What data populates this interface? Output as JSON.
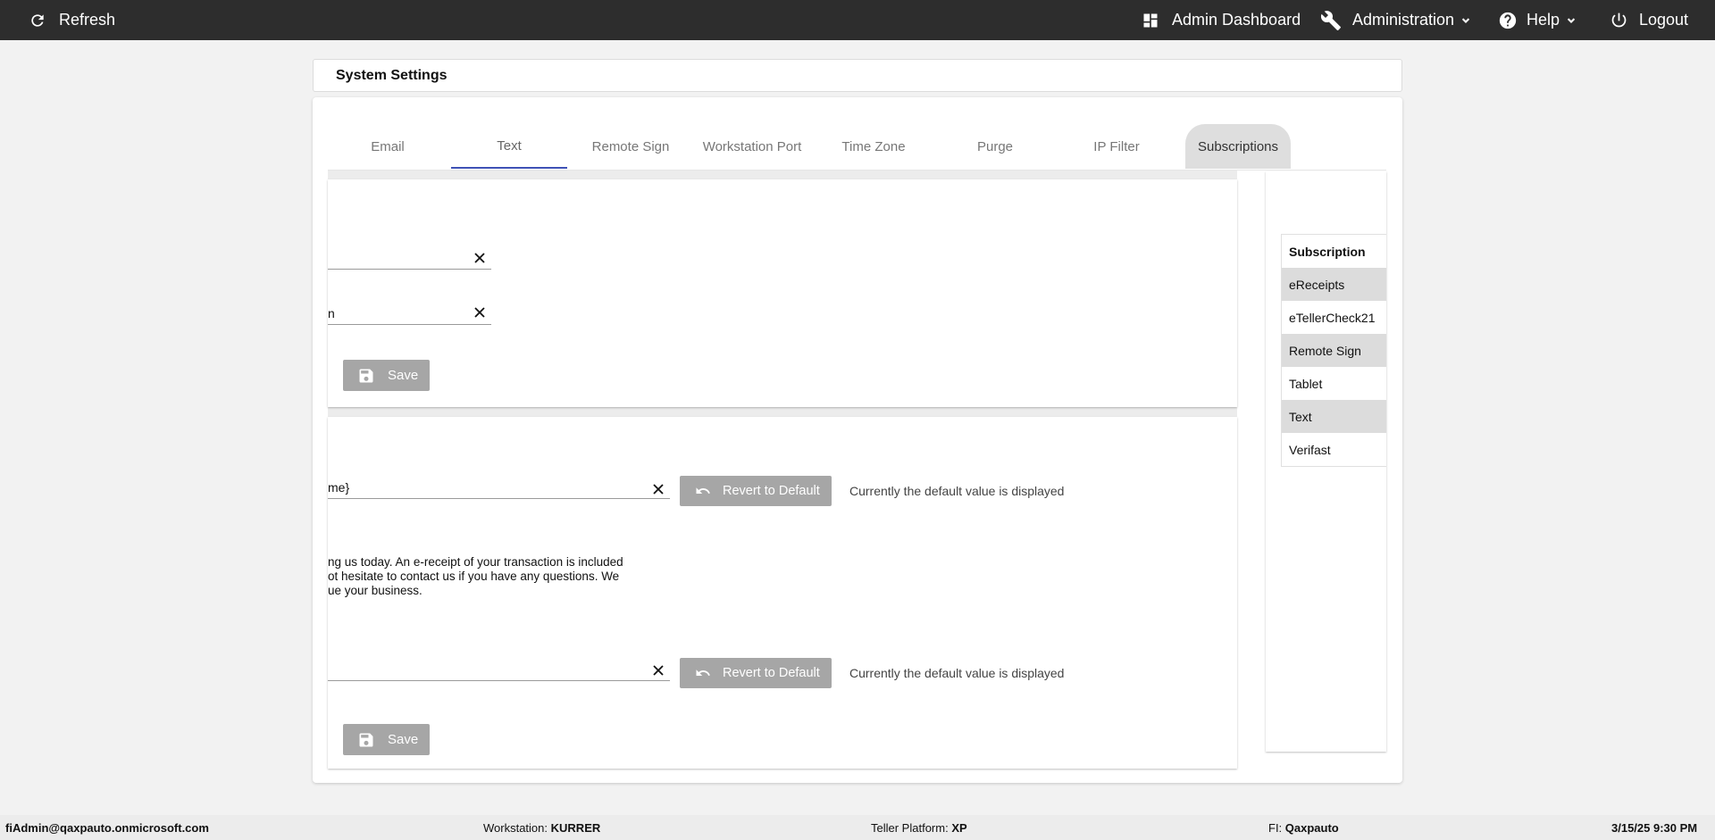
{
  "topbar": {
    "refresh_label": "Refresh",
    "admin_dashboard_label": "Admin Dashboard",
    "administration_label": "Administration",
    "help_label": "Help",
    "logout_label": "Logout"
  },
  "page": {
    "title": "System Settings"
  },
  "tabs": [
    {
      "label": "Email"
    },
    {
      "label": "Text"
    },
    {
      "label": "Remote Sign"
    },
    {
      "label": "Workstation Port"
    },
    {
      "label": "Time Zone"
    },
    {
      "label": "Purge"
    },
    {
      "label": "IP Filter"
    },
    {
      "label": "Subscriptions"
    }
  ],
  "active_tab": "Text",
  "panel1": {
    "field1_value": "",
    "field2_value": "n",
    "save_label": "Save"
  },
  "panel2": {
    "field1_value": "me}",
    "revert_label": "Revert to Default",
    "default_hint": "Currently the default value is displayed",
    "message_lines": [
      "ng us today. An e-receipt of your transaction is included",
      "ot hesitate to contact us if you have any questions. We",
      "ue your business."
    ],
    "field2_value": "",
    "save_label": "Save"
  },
  "subscriptions": {
    "header": "Subscription",
    "items": [
      "eReceipts",
      "eTellerCheck21",
      "Remote Sign",
      "Tablet",
      "Text",
      "Verifast"
    ]
  },
  "footer": {
    "user": "fiAdmin@qaxpauto.onmicrosoft.com",
    "workstation_label": "Workstation:",
    "workstation_value": "KURRER",
    "platform_label": "Teller Platform:",
    "platform_value": "XP",
    "fi_label": "FI:",
    "fi_value": "Qaxpauto",
    "datetime": "3/15/25 9:30 PM"
  },
  "colors": {
    "topbar_bg": "#2d2d2d",
    "tab_active_underline": "#3f51b5",
    "button_disabled_bg": "#a6a6a6"
  }
}
